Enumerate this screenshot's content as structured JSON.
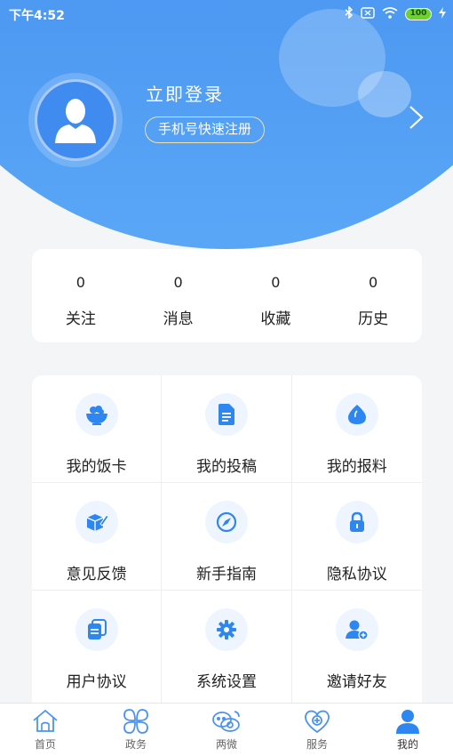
{
  "status_bar": {
    "time": "下午4:52",
    "battery": "100"
  },
  "header": {
    "login_label": "立即登录",
    "register_label": "手机号快速注册"
  },
  "stats": [
    {
      "value": "0",
      "label": "关注"
    },
    {
      "value": "0",
      "label": "消息"
    },
    {
      "value": "0",
      "label": "收藏"
    },
    {
      "value": "0",
      "label": "历史"
    }
  ],
  "grid": [
    {
      "label": "我的饭卡",
      "icon": "rice-bowl-icon"
    },
    {
      "label": "我的投稿",
      "icon": "document-icon"
    },
    {
      "label": "我的报料",
      "icon": "drop-icon"
    },
    {
      "label": "意见反馈",
      "icon": "box-pen-icon"
    },
    {
      "label": "新手指南",
      "icon": "compass-icon"
    },
    {
      "label": "隐私协议",
      "icon": "lock-icon"
    },
    {
      "label": "用户协议",
      "icon": "stacked-docs-icon"
    },
    {
      "label": "系统设置",
      "icon": "gear-icon"
    },
    {
      "label": "邀请好友",
      "icon": "add-user-icon"
    }
  ],
  "tabbar": [
    {
      "label": "首页",
      "icon": "home-icon",
      "active": false
    },
    {
      "label": "政务",
      "icon": "clover-icon",
      "active": false
    },
    {
      "label": "两微",
      "icon": "weibo-icon",
      "active": false
    },
    {
      "label": "服务",
      "icon": "heart-service-icon",
      "active": false
    },
    {
      "label": "我的",
      "icon": "user-icon",
      "active": true
    }
  ],
  "colors": {
    "primary": "#4a93f1",
    "icon_bg": "#eef5ff",
    "register_border": "#f3e0a8"
  }
}
